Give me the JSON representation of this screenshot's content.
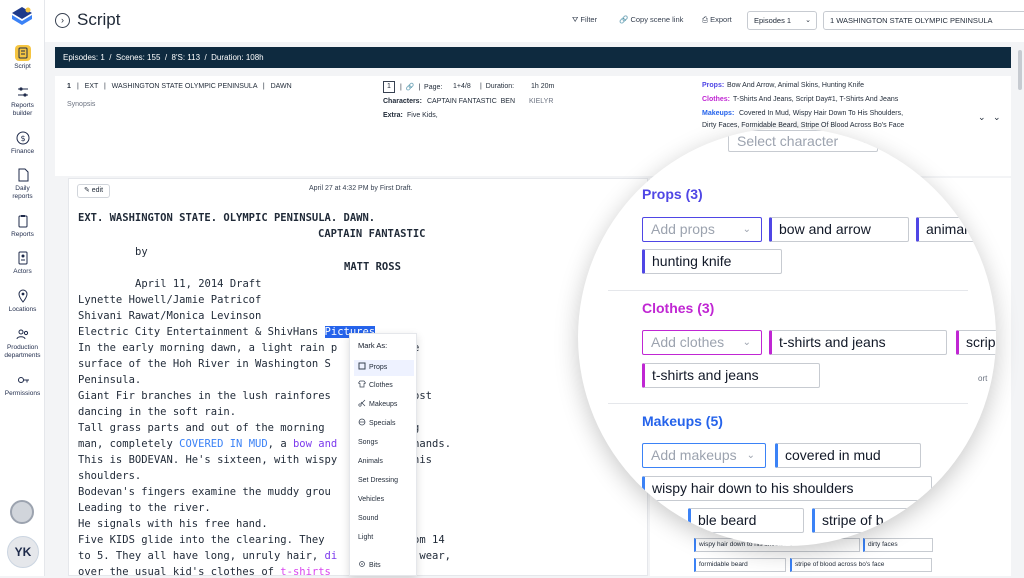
{
  "sidebar": {
    "items": [
      {
        "label": "Script",
        "icon": "script-icon"
      },
      {
        "label": "Reports builder",
        "icon": "sliders-icon"
      },
      {
        "label": "Finance",
        "icon": "dollar-icon"
      },
      {
        "label": "Daily reports",
        "icon": "document-icon"
      },
      {
        "label": "Reports",
        "icon": "clipboard-icon"
      },
      {
        "label": "Actors",
        "icon": "id-card-icon"
      },
      {
        "label": "Locations",
        "icon": "location-pin-icon"
      },
      {
        "label": "Production departments",
        "icon": "people-icon"
      },
      {
        "label": "Permissions",
        "icon": "key-icon"
      }
    ],
    "avatar_initials": "YK"
  },
  "topbar": {
    "title": "Script",
    "filter": "Filter",
    "copy_link": "Copy scene link",
    "export": "Export",
    "episode_select": "Episodes 1",
    "location_select": "1 WASHINGTON STATE OLYMPIC PENINSULA"
  },
  "stats": {
    "text": "Episodes: 1  /  Scenes: 155  /  8'S: 113  /  Duration: 108h"
  },
  "scene": {
    "number": "1",
    "heading": "|   EXT   |   WASHINGTON STATE OLYMPIC PENINSULA   |   DAWN",
    "synopsis": "Synopsis",
    "page_box": "1",
    "page_label": "|  🔗  |  Page:",
    "page_value": "1+4/8",
    "duration_label": "|  Duration:",
    "duration_value": "1h 20m",
    "characters_label": "Characters:",
    "characters": "CAPTAIN FANTASTIC  BEN",
    "characters_grey": "KIELYR",
    "extra_label": "Extra:",
    "extra_value": "Five Kids,",
    "props_label": "Props:",
    "props_value": "Bow And Arrow, Animal Skins, Hunting Knife",
    "clothes_label": "Clothes:",
    "clothes_value": "T-Shirts And Jeans, Script Day#1, T-Shirts And Jeans",
    "makeups_label": "Makeups:",
    "makeups_value": "Covered In Mud, Wispy Hair Down To His Shoulders,",
    "makeups_value2": "Dirty Faces, Formidable Beard, Stripe Of Blood Across Bo's Face"
  },
  "editor": {
    "edit_button": "edit",
    "meta": "April 27 at 4:32 PM by First Draft.",
    "lines": {
      "l1": "EXT. WASHINGTON STATE. OLYMPIC PENINSULA. DAWN.",
      "l2": "CAPTAIN FANTASTIC",
      "l3": "by",
      "l4": "MATT ROSS",
      "l5": "April 11, 2014 Draft",
      "l6": "Lynette Howell/Jamie Patricof",
      "l7": "Shivani Rawat/Monica Levinson",
      "l8a": "Electric City Entertainment & ShivHans ",
      "l8b": "Pictures",
      "l9": "In the early morning dawn, a light rain p     into the",
      "l10": "surface of the Hoh River in Washington S       ympic",
      "l11": "Peninsula.",
      "l12": "Giant Fir branches in the lush rainfores       e, almost",
      "l13": "dancing in the soft rain.",
      "l14": "Tall grass parts and out of the morning        a young",
      "l15a": "man, completely ",
      "l15b": "COVERED IN MUD",
      "l15c": ", a ",
      "l15d": "bow and",
      "l15e": "        his hands.",
      "l16": "This is BODEVAN. He's sixteen, with wispy      wn to his",
      "l17": "shoulders.",
      "l18": "Bodevan's fingers examine the muddy grou       track.",
      "l19": "Leading to the river.",
      "l20": "He signals with his free hand.",
      "l21": "Five KIDS glide into the clearing. They        age from 14",
      "l22a": "to 5. They all have long, unruly hair, ",
      "l22b": "di",
      "l22c": "       , and wear,",
      "l23a": "over the usual kid's clothes of ",
      "l23b": "t-shirts",
      "l23c": "      what"
    }
  },
  "context_menu": {
    "title": "Mark As:",
    "items": [
      "Props",
      "Clothes",
      "Makeups",
      "Specials",
      "Songs",
      "Animals",
      "Set Dressing",
      "Vehicles",
      "Sound",
      "Light",
      "Bits"
    ]
  },
  "magnifier": {
    "select_character": "Select character",
    "props_title": "Props (3)",
    "props_add": "Add props",
    "props_chips": [
      "bow and arrow",
      "animal",
      "hunting knife"
    ],
    "props_duration": "1h 20m",
    "clothes_title": "Clothes (3)",
    "clothes_add": "Add clothes",
    "clothes_chips": [
      "t-shirts and jeans",
      "scrip",
      "t-shirts and jeans"
    ],
    "clothes_side": "ort",
    "makeups_title": "Makeups (5)",
    "makeups_add": "Add makeups",
    "makeups_chips": [
      "covered in mud",
      "wispy hair down to his shoulders",
      "ble beard",
      "stripe of b"
    ]
  },
  "right_small": {
    "makeup_chips": [
      "wispy hair down to his shoulders",
      "dirty faces",
      "formidable beard",
      "stripe of blood across bo's face"
    ]
  },
  "colors": {
    "stats_bg": "#0e2a3f",
    "props": "#4f46e5",
    "clothes": "#c026d3",
    "makeups": "#2563eb",
    "selection": "#2563eb",
    "active_nav": "#f5c542"
  }
}
